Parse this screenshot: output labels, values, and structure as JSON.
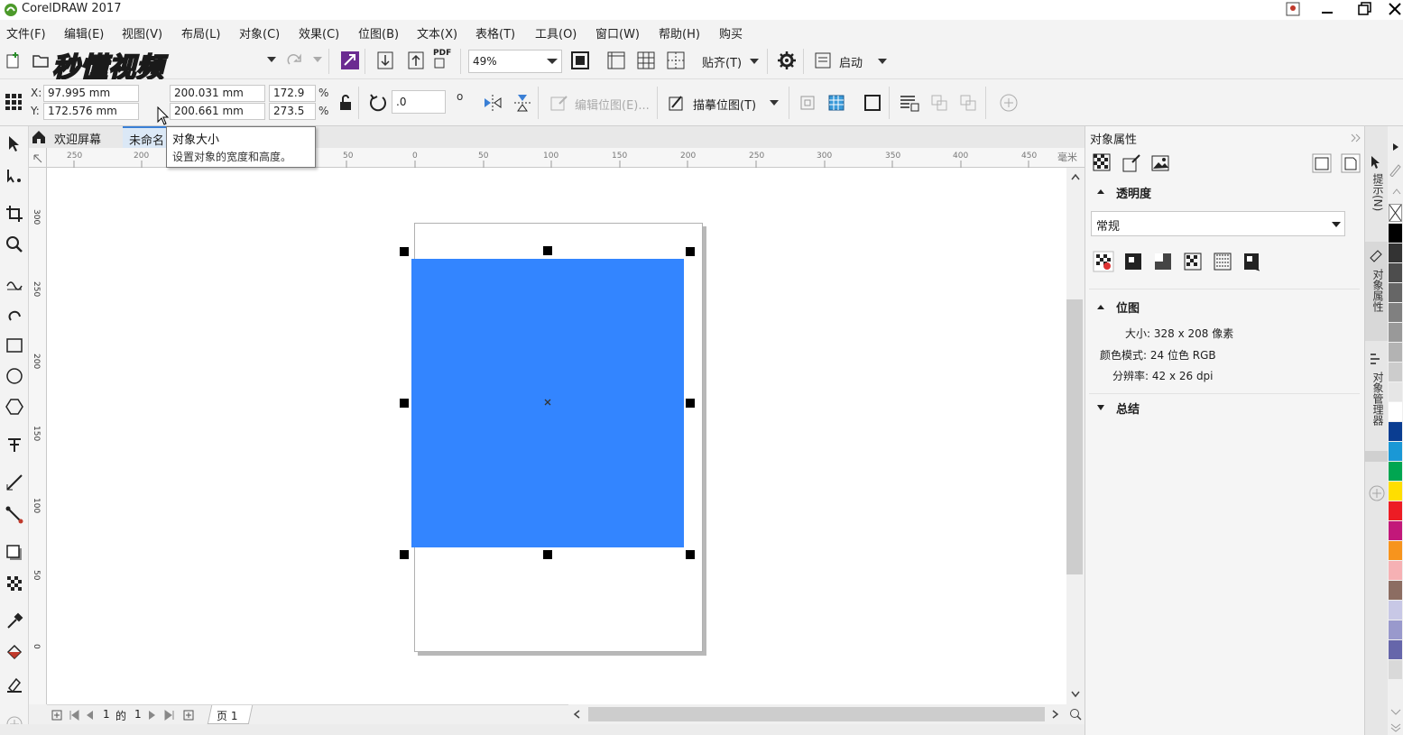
{
  "app": {
    "title": "CorelDRAW 2017"
  },
  "menu": [
    "文件(F)",
    "编辑(E)",
    "视图(V)",
    "布局(L)",
    "对象(C)",
    "效果(C)",
    "位图(B)",
    "文本(X)",
    "表格(T)",
    "工具(O)",
    "窗口(W)",
    "帮助(H)",
    "购买"
  ],
  "watermark": "秒懂视频",
  "toolbar": {
    "zoom": "49%",
    "snap_label": "贴齐(T)",
    "launch_label": "启动",
    "pdf_label": "PDF"
  },
  "property_bar": {
    "x_label": "X:",
    "x_value": "97.995 mm",
    "y_label": "Y:",
    "y_value": "172.576 mm",
    "w_value": "200.031 mm",
    "h_value": "200.661 mm",
    "sx_value": "172.9",
    "sy_value": "273.5",
    "pct": "%",
    "rotation": ".0",
    "deg": "o",
    "edit_bitmap": "编辑位图(E)...",
    "trace_bitmap": "描摹位图(T)"
  },
  "tooltip": {
    "title": "对象大小",
    "desc": "设置对象的宽度和高度。"
  },
  "tabs": {
    "home": "欢迎屏幕",
    "doc": "未命名"
  },
  "ruler": {
    "h_ticks": [
      "250",
      "200",
      "150",
      "50",
      "0",
      "50",
      "100",
      "150",
      "200",
      "250",
      "300",
      "350",
      "400",
      "450"
    ],
    "unit": "毫米",
    "v_ticks": [
      "300",
      "250",
      "200",
      "150",
      "100",
      "50",
      "0"
    ]
  },
  "pager": {
    "current": "1",
    "of": "的",
    "total": "1",
    "page_tab": "页 1"
  },
  "colors": {
    "object_fill": "#3385ff",
    "accent": "#3a7fd5"
  },
  "docker": {
    "title": "对象属性",
    "transparency_header": "透明度",
    "transparency_mode": "常规",
    "bitmap_header": "位图",
    "size_text": "大小: 328 x 208 像素",
    "color_mode": "颜色模式: 24 位色 RGB",
    "resolution": "分辨率: 42 x 26 dpi",
    "summary_header": "总结"
  },
  "side_tabs": [
    "提示(N)",
    "对象属性",
    "对象管理器"
  ],
  "palette": [
    "#ffffff",
    "#000000",
    "#333333",
    "#4d4d4d",
    "#666666",
    "#808080",
    "#999999",
    "#b3b3b3",
    "#cccccc",
    "#e6e6e6",
    "#ffffff",
    "#0a3d91",
    "#1a98d6",
    "#00a651",
    "#ffde00",
    "#ed1c24",
    "#c2187a",
    "#f7941d",
    "#f6b1b4",
    "#8c6d62",
    "#c8c8e6",
    "#9999cc",
    "#6666aa",
    "#d9d9d9"
  ]
}
